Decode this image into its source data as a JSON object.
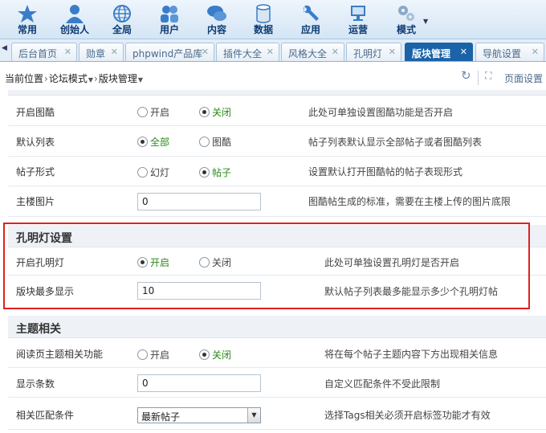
{
  "toolbar": {
    "items": [
      {
        "label": "常用",
        "icon": "star-icon"
      },
      {
        "label": "创始人",
        "icon": "user-icon"
      },
      {
        "label": "全局",
        "icon": "globe-icon"
      },
      {
        "label": "用户",
        "icon": "users-icon"
      },
      {
        "label": "内容",
        "icon": "chat-icon"
      },
      {
        "label": "数据",
        "icon": "database-icon"
      },
      {
        "label": "应用",
        "icon": "wrench-icon"
      },
      {
        "label": "运营",
        "icon": "monitor-icon"
      },
      {
        "label": "模式",
        "icon": "gears-icon"
      }
    ]
  },
  "tabs": [
    {
      "label": "后台首页"
    },
    {
      "label": "勋章"
    },
    {
      "label": "phpwind产品库"
    },
    {
      "label": "插件大全"
    },
    {
      "label": "风格大全"
    },
    {
      "label": "孔明灯"
    },
    {
      "label": "版块管理",
      "active": true
    },
    {
      "label": "导航设置"
    }
  ],
  "breadcrumb": {
    "lead": "当前位置",
    "sep": "›",
    "items": [
      "论坛模式",
      "版块管理"
    ]
  },
  "tools": {
    "settings_label": "页面设置"
  },
  "rows": {
    "pic_enable": {
      "label": "开启图酷",
      "opt1": "开启",
      "opt2": "关闭",
      "desc": "此处可单独设置图酷功能是否开启"
    },
    "default_list": {
      "label": "默认列表",
      "opt1": "全部",
      "opt2": "图酷",
      "desc": "帖子列表默认显示全部帖子或者图酷列表"
    },
    "post_form": {
      "label": "帖子形式",
      "opt1": "幻灯",
      "opt2": "帖子",
      "desc": "设置默认打开图酷帖的帖子表现形式"
    },
    "main_pic": {
      "label": "主楼图片",
      "value": "0",
      "desc": "图酷帖生成的标准，需要在主楼上传的图片底限"
    }
  },
  "kongming": {
    "title": "孔明灯设置",
    "enable": {
      "label": "开启孔明灯",
      "opt1": "开启",
      "opt2": "关闭",
      "desc": "此处可单独设置孔明灯是否开启"
    },
    "max_show": {
      "label": "版块最多显示",
      "value": "10",
      "desc": "默认帖子列表最多能显示多少个孔明灯帖"
    }
  },
  "topic": {
    "title": "主题相关",
    "read_related": {
      "label": "阅读页主题相关功能",
      "opt1": "开启",
      "opt2": "关闭",
      "desc": "将在每个帖子主题内容下方出现相关信息"
    },
    "count": {
      "label": "显示条数",
      "value": "0",
      "desc": "自定义匹配条件不受此限制"
    },
    "match": {
      "label": "相关匹配条件",
      "value": "最新帖子",
      "desc": "选择Tags相关必须开启标签功能才有效"
    }
  },
  "colors": {
    "accent": "#1b63a8",
    "highlight": "#e02020",
    "checked_text": "#2a8a17"
  }
}
